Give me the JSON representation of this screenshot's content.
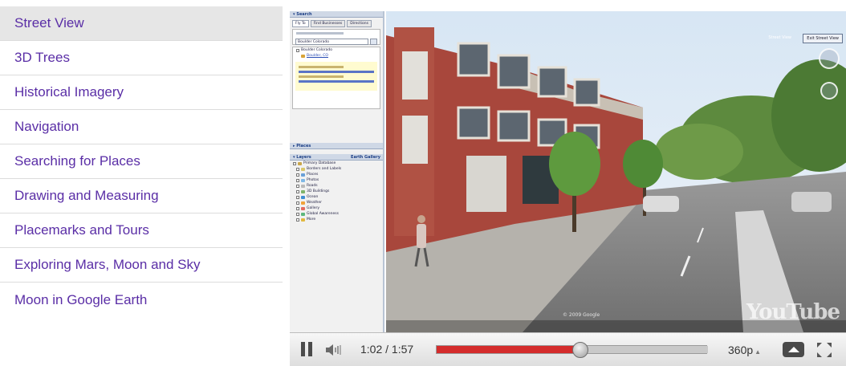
{
  "nav": {
    "items": [
      {
        "label": "Street View",
        "active": true
      },
      {
        "label": "3D Trees"
      },
      {
        "label": "Historical Imagery"
      },
      {
        "label": "Navigation"
      },
      {
        "label": "Searching for Places"
      },
      {
        "label": "Drawing and Measuring"
      },
      {
        "label": "Placemarks and Tours"
      },
      {
        "label": "Exploring Mars, Moon and Sky"
      },
      {
        "label": "Moon in Google Earth"
      }
    ],
    "link_color": "#5a2ea6",
    "active_bg": "#e6e6e6"
  },
  "earth": {
    "search_header": "Search",
    "tabs": [
      "Fly To",
      "Find Businesses",
      "Directions"
    ],
    "search_value": "Boulder Colorado",
    "result_title": "Boulder Colorado",
    "result_link": "Boulder, CO",
    "places_header": "Places",
    "layers_header": "Layers",
    "layers_gallery": "Earth Gallery",
    "layers": [
      {
        "label": "Primary Database",
        "icon": "#c9a64b"
      },
      {
        "label": "Borders and Labels",
        "icon": "#d9c66a"
      },
      {
        "label": "Places",
        "icon": "#6aa0d8"
      },
      {
        "label": "Photos",
        "icon": "#7eb7e5"
      },
      {
        "label": "Roads",
        "icon": "#b9b9b9"
      },
      {
        "label": "3D Buildings",
        "icon": "#7fb46a"
      },
      {
        "label": "Ocean",
        "icon": "#3f8fd4"
      },
      {
        "label": "Weather",
        "icon": "#f0a23a"
      },
      {
        "label": "Gallery",
        "icon": "#e46a5e"
      },
      {
        "label": "Global Awareness",
        "icon": "#5db77d"
      },
      {
        "label": "More",
        "icon": "#e1b840"
      }
    ],
    "exit_street_view": "Exit Street View",
    "youtube_logo": "YouTube",
    "google_logo": "Google"
  },
  "player": {
    "current_time": "1:02",
    "total_time": "1:57",
    "time_text": "1:02 / 1:57",
    "progress_fraction": 0.53,
    "buffered_fraction": 1.0,
    "quality": "360p",
    "accent": "#d42c2c"
  }
}
